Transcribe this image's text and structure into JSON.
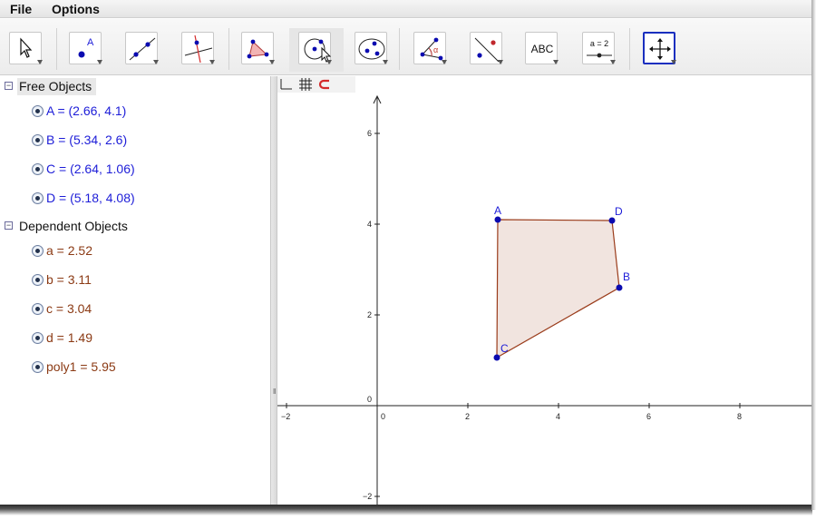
{
  "menu": {
    "file": "File",
    "options": "Options"
  },
  "toolbar": {
    "tools": [
      {
        "name": "move-tool",
        "icon": "arrow-cursor-icon"
      },
      {
        "name": "new-point-tool",
        "icon": "point-icon",
        "label": "A"
      },
      {
        "name": "line-tool",
        "icon": "line-through-points-icon"
      },
      {
        "name": "perpendicular-line-tool",
        "icon": "perpendicular-line-icon"
      },
      {
        "name": "polygon-tool",
        "icon": "polygon-icon"
      },
      {
        "name": "circle-tool",
        "icon": "circle-center-point-icon"
      },
      {
        "name": "conic-tool",
        "icon": "ellipse-icon"
      },
      {
        "name": "angle-tool",
        "icon": "angle-icon",
        "label": "α"
      },
      {
        "name": "reflect-tool",
        "icon": "reflect-about-line-icon"
      },
      {
        "name": "text-tool",
        "icon": "text-icon",
        "label": "ABC"
      },
      {
        "name": "slider-tool",
        "icon": "slider-icon",
        "label": "a = 2"
      },
      {
        "name": "move-view-tool",
        "icon": "move-graphics-view-icon"
      }
    ]
  },
  "algebra": {
    "free": {
      "title": "Free Objects",
      "items": [
        {
          "text": "A = (2.66, 4.1)"
        },
        {
          "text": "B = (5.34, 2.6)"
        },
        {
          "text": "C = (2.64, 1.06)"
        },
        {
          "text": "D = (5.18, 4.08)"
        }
      ]
    },
    "dependent": {
      "title": "Dependent Objects",
      "items": [
        {
          "text": "a = 2.52"
        },
        {
          "text": "b = 3.11"
        },
        {
          "text": "c = 3.04"
        },
        {
          "text": "d = 1.49"
        },
        {
          "text": "poly1 = 5.95"
        }
      ]
    }
  },
  "graphics": {
    "x_ticks": [
      -2,
      0,
      2,
      4,
      6,
      8
    ],
    "y_ticks": [
      -2,
      0,
      2,
      4,
      6
    ],
    "points": [
      {
        "name": "A",
        "x": 2.66,
        "y": 4.1
      },
      {
        "name": "B",
        "x": 5.34,
        "y": 2.6
      },
      {
        "name": "C",
        "x": 2.64,
        "y": 1.06
      },
      {
        "name": "D",
        "x": 5.18,
        "y": 4.08
      }
    ],
    "polygon_order": [
      "A",
      "D",
      "B",
      "C"
    ],
    "colors": {
      "point": "#0b0bb0",
      "polygon_edge": "#9a3b1a",
      "polygon_fill": "#f1e4df",
      "axis": "#222222"
    }
  }
}
